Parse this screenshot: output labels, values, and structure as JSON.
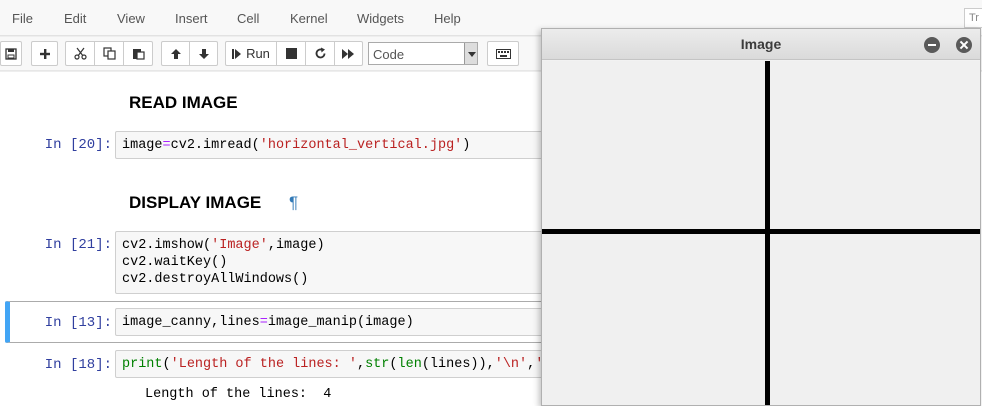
{
  "menu": {
    "items": [
      "File",
      "Edit",
      "View",
      "Insert",
      "Cell",
      "Kernel",
      "Widgets",
      "Help"
    ],
    "trusted_label": "Tr"
  },
  "toolbar": {
    "run_label": "Run",
    "cell_type_value": "Code",
    "icons": [
      "save-icon",
      "plus-icon",
      "scissors-icon",
      "copy-icon",
      "paste-icon",
      "arrow-up-icon",
      "arrow-down-icon",
      "run-step-icon",
      "stop-icon",
      "restart-icon",
      "fast-forward-icon",
      "keyboard-icon"
    ]
  },
  "cells": [
    {
      "type": "heading",
      "text": "READ IMAGE"
    },
    {
      "type": "code",
      "prompt": "In [20]:",
      "source": "image=cv2.imread('horizontal_vertical.jpg')"
    },
    {
      "type": "heading",
      "text": "DISPLAY IMAGE",
      "anchor": "¶"
    },
    {
      "type": "code",
      "prompt": "In [21]:",
      "source": "cv2.imshow('Image',image)\ncv2.waitKey()\ncv2.destroyAllWindows()"
    },
    {
      "type": "code",
      "prompt": "In [13]:",
      "source": "image_canny,lines=image_manip(image)",
      "selected": true
    },
    {
      "type": "code",
      "prompt": "In [18]:",
      "source": "print('Length of the lines: ',str(len(lines)),'\\n','L",
      "output": "Length of the lines:  4"
    }
  ],
  "image_window": {
    "title": "Image"
  }
}
